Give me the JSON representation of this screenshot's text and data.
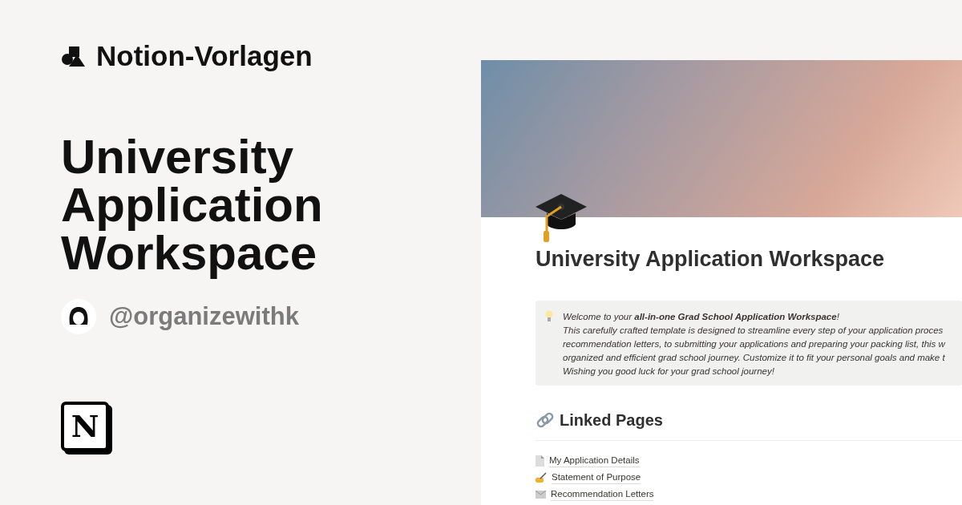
{
  "brand": {
    "name": "Notion-Vorlagen"
  },
  "title_lines": [
    "University",
    "Application",
    "Workspace"
  ],
  "author": {
    "handle": "@organizewithk"
  },
  "logo_mark": "N",
  "page": {
    "title": "University Application Workspace",
    "callout": [
      "Welcome to your **all-in-one Grad School Application Workspace**!",
      "This carefully crafted template is designed to streamline every step of your application proces",
      "recommendation letters, to submitting your applications and preparing your packing list, this w",
      "organized and efficient grad school journey. Customize it to fit your personal goals and make t",
      "Wishing you good luck for your grad school journey!"
    ],
    "section_heading": "Linked Pages",
    "links": [
      {
        "kind": "document",
        "label": "My Application Details"
      },
      {
        "kind": "writing",
        "label": "Statement of Purpose"
      },
      {
        "kind": "letter",
        "label": "Recommendation Letters"
      }
    ]
  }
}
